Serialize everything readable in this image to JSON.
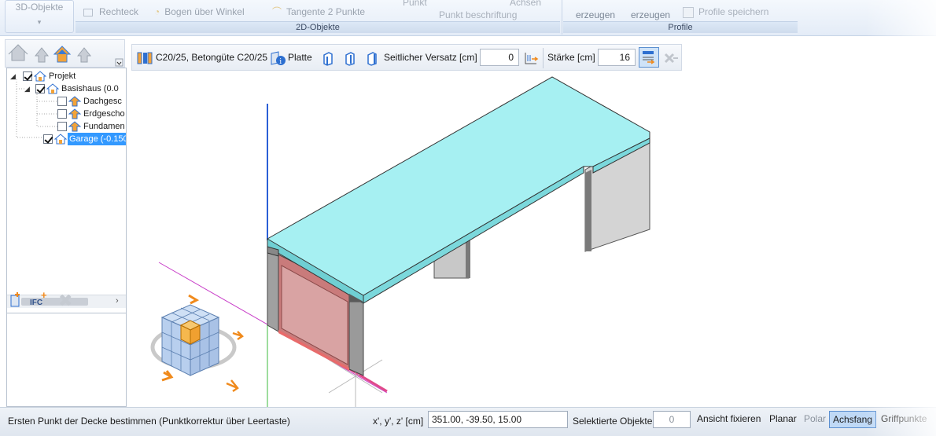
{
  "ribbon": {
    "groups": [
      {
        "caption": "2D-Objekte",
        "buttons": [
          "Rechteck",
          "Bogen über Winkel",
          "Tangente 2 Punkte",
          "Punkt",
          "Punkt beschriftung",
          "Achsen"
        ]
      },
      {
        "caption": "Profile",
        "buttons": [
          "erzeugen",
          "erzeugen",
          "Profile speichern"
        ]
      }
    ],
    "big_button": "3D-Objekte"
  },
  "tree": {
    "nodes": [
      {
        "label": "Projekt",
        "checked": true
      },
      {
        "label": "Basishaus (0.0",
        "checked": true
      },
      {
        "label": "Dachgesc",
        "checked": false
      },
      {
        "label": "Erdgescho",
        "checked": false
      },
      {
        "label": "Fundamen",
        "checked": false
      },
      {
        "label": "Garage (-0.150",
        "checked": true
      }
    ]
  },
  "ifc": {
    "label": "IFC"
  },
  "properties": {
    "material": "C20/25, Betongüte C20/25",
    "type": "Platte",
    "offset_label": "Seitlicher Versatz [cm]",
    "offset_value": "0",
    "thickness_label": "Stärke [cm]",
    "thickness_value": "16"
  },
  "status": {
    "prompt": "Ersten Punkt der Decke bestimmen (Punktkorrektur über Leertaste)",
    "coord_label": "x', y', z' [cm]",
    "coord_value": "351.00, -39.50, 15.00",
    "selected_label": "Selektierte Objekte",
    "selected_count": "0",
    "toggles": [
      "Ansicht fixieren",
      "Planar",
      "Polar",
      "Achsfang",
      "Griffpunkte"
    ]
  },
  "colors": {
    "slab_top": "#a6f0f2",
    "slab_side": "#6fcfd3",
    "wall": "#d4d4d4",
    "red_wall": "#c97b7b",
    "active_toggle": "#bfd9f6"
  }
}
